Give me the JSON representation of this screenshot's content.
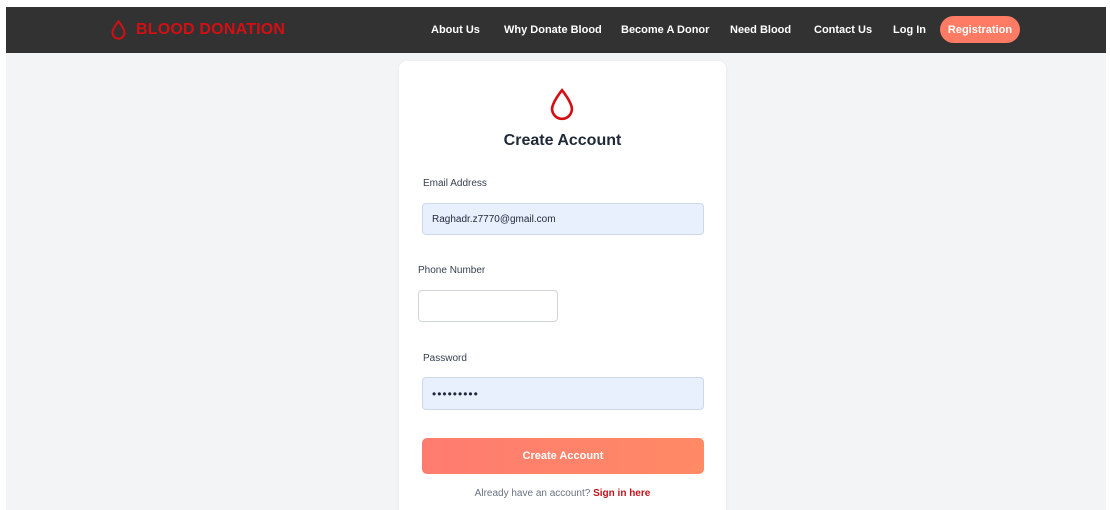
{
  "colors": {
    "brand_red": "#d40f14",
    "navbar_bg": "#323232",
    "accent_coral": "#ff7b63",
    "input_autofill_bg": "#e8f0fe",
    "page_bg": "#f3f4f6"
  },
  "navbar": {
    "brand": {
      "icon": "blood-drop-icon",
      "label": "BLOOD DONATION"
    },
    "links": {
      "about": "About Us",
      "why_donate": "Why Donate Blood",
      "become_donor": "Become A Donor",
      "need_blood": "Need Blood",
      "contact": "Contact Us",
      "login": "Log In"
    },
    "register_button": "Registration"
  },
  "form": {
    "icon": "blood-drop-icon",
    "title": "Create Account",
    "email": {
      "label": "Email Address",
      "value": "Raghadr.z7770@gmail.com"
    },
    "phone": {
      "label": "Phone Number",
      "value": ""
    },
    "password": {
      "label": "Password",
      "value": "•••••••••"
    },
    "submit_label": "Create Account",
    "signin_prompt": "Already have an account?",
    "signin_link": "Sign in here"
  }
}
